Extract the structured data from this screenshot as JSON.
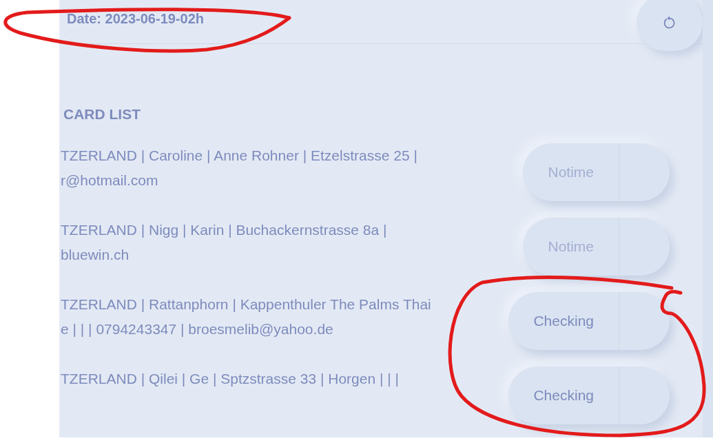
{
  "header": {
    "date": "Date: 2023-06-19-02h"
  },
  "card_list": {
    "title": "CARD LIST",
    "rows": [
      {
        "text": [
          "TZERLAND | Caroline | Anne Rohner | Etzelstrasse 25 |",
          "r@hotmail.com"
        ],
        "button": {
          "label": "Notime",
          "disabled": true
        }
      },
      {
        "text": [
          "TZERLAND | Nigg | Karin | Buchackernstrasse 8a |",
          "bluewin.ch"
        ],
        "button": {
          "label": "Notime",
          "disabled": true
        }
      },
      {
        "text": [
          "TZERLAND | Rattanphorn | Kappenthuler The Palms Thai",
          "e | | | 0794243347 | broesmelib@yahoo.de"
        ],
        "button": {
          "label": "Checking",
          "disabled": false
        }
      },
      {
        "text": [
          "TZERLAND | Qilei | Ge | Sptzstrasse 33 | Horgen | | |"
        ],
        "button": {
          "label": "Checking",
          "disabled": false
        }
      }
    ]
  }
}
